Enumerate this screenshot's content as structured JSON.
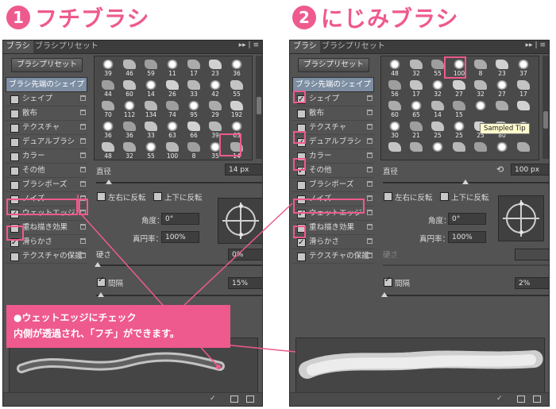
{
  "heading1": {
    "number": "1",
    "title": "フチブラシ"
  },
  "heading2": {
    "number": "2",
    "title": "にじみブラシ"
  },
  "panel1": {
    "tabs": [
      "ブラシ",
      "ブラシプリセット"
    ],
    "preset_button": "ブラシプリセット",
    "tip_shape": "ブラシ先端のシェイプ",
    "items": [
      {
        "label": "シェイプ",
        "checked": false
      },
      {
        "label": "散布",
        "checked": false
      },
      {
        "label": "テクスチャ",
        "checked": false
      },
      {
        "label": "デュアルブラシ",
        "checked": false
      },
      {
        "label": "カラー",
        "checked": false
      },
      {
        "label": "その他",
        "checked": false
      },
      {
        "label": "ブラシポーズ",
        "checked": false
      },
      {
        "label": "ノイズ",
        "checked": false
      },
      {
        "label": "ウェットエッジ",
        "checked": true
      },
      {
        "label": "重ね描き効果",
        "checked": false
      },
      {
        "label": "滑らかさ",
        "checked": true
      },
      {
        "label": "テクスチャの保護",
        "checked": false
      }
    ],
    "brush_rows": [
      [
        "39",
        "46",
        "59",
        "11",
        "17",
        "23",
        "36"
      ],
      [
        "44",
        "60",
        "14",
        "26",
        "33",
        "42",
        "55"
      ],
      [
        "70",
        "112",
        "134",
        "74",
        "95",
        "29",
        "192"
      ],
      [
        "36",
        "36",
        "33",
        "63",
        "66",
        "39",
        "63"
      ],
      [
        "48",
        "32",
        "55",
        "100",
        "8",
        "35",
        "14"
      ]
    ],
    "diameter_label": "直径",
    "diameter_value": "14 px",
    "flip_x": "左右に反転",
    "flip_y": "上下に反転",
    "angle_label": "角度：",
    "angle_value": "0°",
    "roundness_label": "真円率：",
    "roundness_value": "100%",
    "hardness_label": "硬さ",
    "hardness_value": "0%",
    "spacing_label": "間隔",
    "spacing_value": "15%"
  },
  "panel2": {
    "tabs": [
      "ブラシ",
      "ブラシプリセット"
    ],
    "preset_button": "ブラシプリセット",
    "tip_shape": "ブラシ先端のシェイプ",
    "items": [
      {
        "label": "シェイプ",
        "checked": true
      },
      {
        "label": "散布",
        "checked": false
      },
      {
        "label": "テクスチャ",
        "checked": false
      },
      {
        "label": "デュアルブラシ",
        "checked": true
      },
      {
        "label": "カラー",
        "checked": false
      },
      {
        "label": "その他",
        "checked": true
      },
      {
        "label": "ブラシポーズ",
        "checked": false
      },
      {
        "label": "ノイズ",
        "checked": false
      },
      {
        "label": "ウェットエッジ",
        "checked": true
      },
      {
        "label": "重ね描き効果",
        "checked": false
      },
      {
        "label": "滑らかさ",
        "checked": true
      },
      {
        "label": "テクスチャの保護",
        "checked": false
      }
    ],
    "brush_rows": [
      [
        "48",
        "32",
        "55",
        "100",
        "8",
        "23",
        "37"
      ],
      [
        "56",
        "17",
        "32",
        "27",
        "32",
        "27",
        "17"
      ],
      [
        "60",
        "65",
        "14",
        "15",
        "",
        "",
        ""
      ],
      [
        "30",
        "21",
        "25",
        "25",
        "25",
        "80",
        ""
      ],
      [
        "",
        "",
        "",
        "",
        "",
        "",
        ""
      ]
    ],
    "tooltip": "Sampled Tip",
    "diameter_label": "直径",
    "diameter_value": "100 px",
    "flip_x": "左右に反転",
    "flip_y": "上下に反転",
    "angle_label": "角度：",
    "angle_value": "0°",
    "roundness_label": "真円率：",
    "roundness_value": "100%",
    "hardness_label": "硬さ",
    "spacing_label": "間隔",
    "spacing_value": "2%"
  },
  "callout": {
    "line1": "●ウェットエッジにチェック",
    "line2": "内側が透過され、「フチ」ができます。"
  },
  "colors": {
    "accent": "#ee5a8e",
    "panel": "#535353"
  }
}
